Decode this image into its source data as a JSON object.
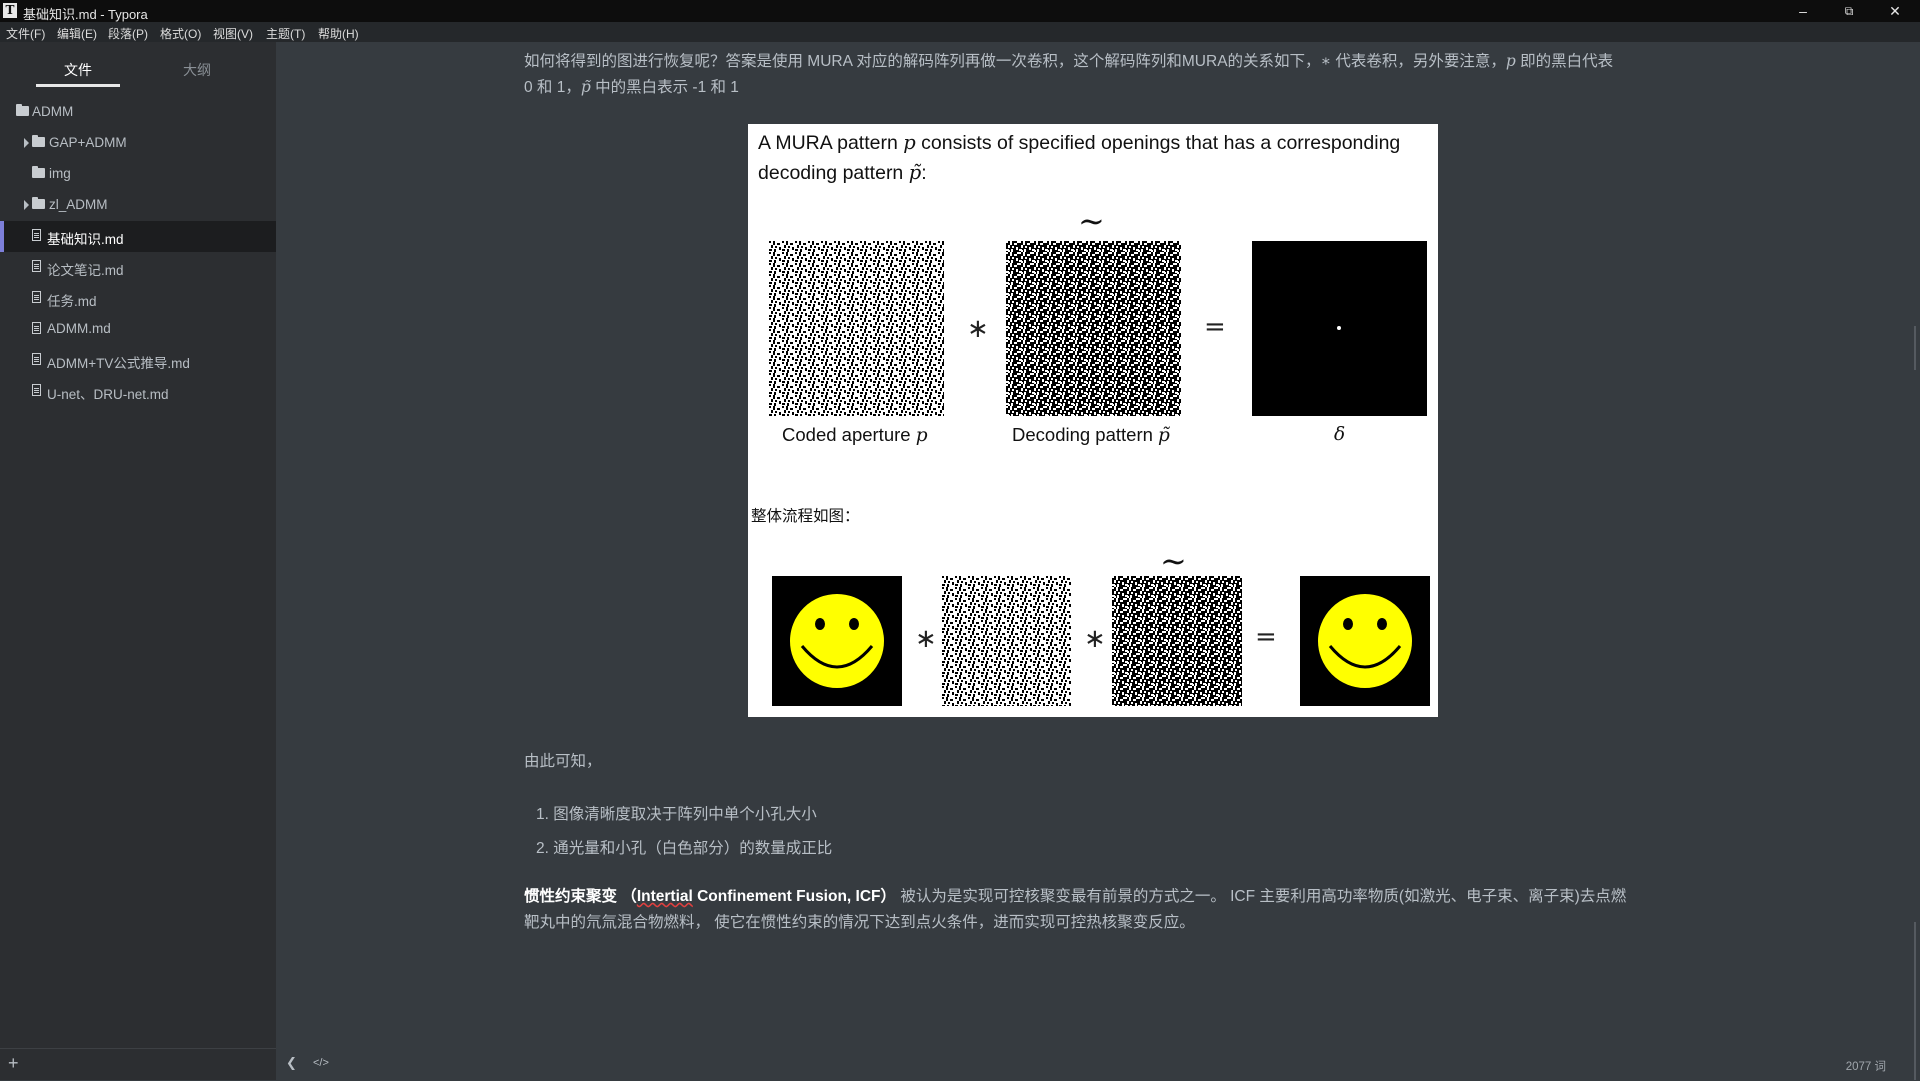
{
  "window": {
    "title": "基础知识.md - Typora",
    "app_icon": "T",
    "controls": [
      "minimize-icon",
      "restore-icon",
      "close-icon"
    ]
  },
  "menu": [
    "文件(F)",
    "编辑(E)",
    "段落(P)",
    "格式(O)",
    "视图(V)",
    "主题(T)",
    "帮助(H)"
  ],
  "sidebar": {
    "tabs": [
      {
        "label": "文件",
        "active": true
      },
      {
        "label": "大纲",
        "active": false
      }
    ],
    "tree": [
      {
        "label": "ADMM",
        "kind": "folder",
        "expanded": true
      },
      {
        "label": "GAP+ADMM",
        "kind": "folder",
        "collapsible": true
      },
      {
        "label": "img",
        "kind": "folder"
      },
      {
        "label": "zl_ADMM",
        "kind": "folder",
        "collapsible": true
      },
      {
        "label": "基础知识.md",
        "kind": "file",
        "active": true
      },
      {
        "label": "论文笔记.md",
        "kind": "file"
      },
      {
        "label": "任务.md",
        "kind": "file"
      },
      {
        "label": "ADMM.md",
        "kind": "file"
      },
      {
        "label": "ADMM+TV公式推导.md",
        "kind": "file"
      },
      {
        "label": "U-net、DRU-net.md",
        "kind": "file"
      }
    ],
    "add_label": "+"
  },
  "content": {
    "intro_line1_a": "如何将得到的图进行恢复呢？答案是使用 MURA 对应的解码阵列再做一次卷积，这个解码阵列和MURA的关系如下，",
    "intro_star": "∗",
    "intro_line1_b": " 代表卷积，另外要注意，",
    "intro_p": "p",
    "intro_line1_c": " 即的黑白代表",
    "intro_line2_a": "0 和 1，",
    "intro_ptilde": "p̃",
    "intro_line2_b": " 中的黑白表示 -1 和 1",
    "figure": {
      "text_a": "A MURA pattern ",
      "text_p": "p",
      "text_b": " consists of specified openings that has a corresponding",
      "text_c": "decoding pattern ",
      "text_ptilde": "p̃",
      "text_d": ":",
      "caption1": "Coded aperture ",
      "caption1_math": "p",
      "caption2": "Decoding pattern ",
      "caption2_math": "p̃",
      "caption3": "δ",
      "op_star": "∗",
      "op_eq": "=",
      "tilde": "∼",
      "sub_label": "整体流程如图：",
      "smiley_color": "#ffff00"
    },
    "after_figure": "由此可知，",
    "list": [
      "图像清晰度取决于阵列中单个小孔大小",
      "通光量和小孔（白色部分）的数量成正比"
    ],
    "icf_bold_a": "惯性约束聚变  （",
    "icf_bold_err": "Intertial",
    "icf_bold_b": " Confinement Fusion, ICF）",
    "icf_rest": " 被认为是实现可控核聚变最有前景的方式之一。 ICF 主要利用高功率物质(如激光、电子束、离子束)去点燃",
    "icf_line2": "靶丸中的氘氚混合物燃料， 使它在惯性约束的情况下达到点火条件，进而实现可控热核聚变反应。"
  },
  "status": {
    "word_count": "2077 词",
    "back_icon": "chevron-left-icon",
    "source_icon": "code-icon"
  }
}
